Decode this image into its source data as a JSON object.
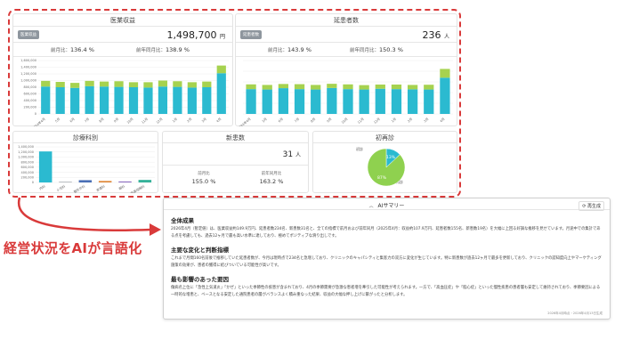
{
  "colors": {
    "accent_red": "#d93a3a",
    "bar_teal": "#2bbad0",
    "bar_green": "#a6d24f",
    "pie_green": "#8fd14f"
  },
  "revenue": {
    "title": "医業収益",
    "badge": "医業収益",
    "value": "1,498,700",
    "unit": "円",
    "mom_label": "前月比：",
    "mom_value": "136.4 %",
    "yoy_label": "前年同月比：",
    "yoy_value": "138.9 %"
  },
  "patients": {
    "title": "延患者数",
    "badge": "延患者数",
    "value": "236",
    "unit": "人",
    "mom_label": "前月比：",
    "mom_value": "143.9 %",
    "yoy_label": "前年同月比：",
    "yoy_value": "150.3 %"
  },
  "department": {
    "title": "診療科別"
  },
  "new_patients": {
    "title": "新患数",
    "value": "31",
    "unit": "人",
    "mom_label": "前月比",
    "mom_value": "155.0 %",
    "yoy_label": "前年同月比",
    "yoy_value": "163.2 %"
  },
  "first_visit": {
    "title": "初再診",
    "legend_first": "初診",
    "legend_repeat": "再診"
  },
  "chart_data": [
    {
      "type": "bar",
      "title": "",
      "categories": [
        "2024年4月",
        "5月",
        "6月",
        "7月",
        "8月",
        "9月",
        "10月",
        "11月",
        "12月",
        "1月",
        "2月",
        "3月",
        "4月"
      ],
      "yticks": [
        "0",
        "200,000",
        "400,000",
        "600,000",
        "800,000",
        "1,000,000",
        "1,200,000",
        "1,400,000",
        "1,600,000"
      ],
      "ylim": [
        0,
        1600000
      ],
      "series": [
        {
          "values": [
            820000,
            800000,
            780000,
            830000,
            820000,
            810000,
            800000,
            790000,
            820000,
            810000,
            790000,
            800000,
            1220000
          ]
        },
        {
          "values": [
            170000,
            160000,
            150000,
            160000,
            150000,
            170000,
            150000,
            160000,
            180000,
            170000,
            160000,
            170000,
            230000
          ]
        }
      ]
    },
    {
      "type": "bar",
      "title": "",
      "categories": [
        "2024年4月",
        "5月",
        "6月",
        "7月",
        "8月",
        "9月",
        "10月",
        "11月",
        "12月",
        "1月",
        "2月",
        "3月",
        "4月"
      ],
      "ylim": [
        0,
        280
      ],
      "series": [
        {
          "values": [
            130,
            128,
            135,
            130,
            128,
            136,
            130,
            128,
            132,
            130,
            129,
            128,
            190
          ]
        },
        {
          "values": [
            25,
            24,
            22,
            26,
            24,
            22,
            25,
            23,
            22,
            24,
            23,
            25,
            46
          ]
        }
      ]
    },
    {
      "type": "bar",
      "title": "",
      "categories": [
        "内科",
        "小児科",
        "整形外科",
        "皮膚科",
        "眼科",
        "耳鼻咽喉科"
      ],
      "yticks": [
        "0",
        "200,000",
        "400,000",
        "600,000",
        "800,000",
        "1,000,000",
        "1,200,000",
        "1,400,000"
      ],
      "ylim": [
        0,
        1400000
      ],
      "values": [
        1220000,
        30000,
        90000,
        60000,
        40000,
        100000
      ]
    },
    {
      "type": "pie",
      "title": "",
      "categories": [
        "初診",
        "再診"
      ],
      "values": [
        13,
        87
      ],
      "labels": [
        "13%",
        "87%"
      ]
    }
  ],
  "annotation": {
    "text": "経営状況をAIが言語化"
  },
  "ai_summary": {
    "title": "AIサマリー",
    "regenerate": "再生成",
    "h1": "全体成果",
    "p1": "2026年4月（暫定値）は、医業収益約149.9万円、延患者数234名、新患数31名と、全ての指標で前月および前年同月（2025年4月：収益約107.9万円、延患者数155名、新患数19名）を大幅に上回る好調な推移を見せています。月途中での集計である点を考慮しても、過去12ヶ月で最も高い水準に達しており、極めてポジティブな滑り出しです。",
    "h2": "主要な変化と判断指標",
    "p2": "これまで月間160名前後で推移していた延患者数が、今月は現時点で234名と急増しており、クリニックのキャパシティと集客力の双方に変化が生じています。特に新患数が過去12ヶ月で最多を更新しており、クリニックの認知度向上やマーケティング施策の効果が、患者の獲得に結びついている可能性が高いです。",
    "h3": "最も影響のあった要因",
    "p3": "傷病名上位に「急性上気道炎」「かぜ」といった季節性の疾患が含まれており、4月の季節需要が急激な患者増を牽引した可能性が考えられます。一方で、「高血圧症」や「脂心症」といった慢性疾患の患者層も安定して維持されており、季節要因による一時的な増患と、ベースとなる安定した通院患者の層がバランスよく積み重なった結果、収益の大幅な押し上げに繋がったと分析します。",
    "footer": "2026年4月時点・2026年4月13日生成"
  }
}
